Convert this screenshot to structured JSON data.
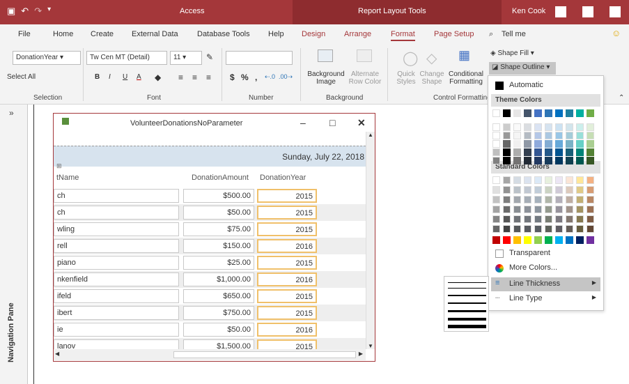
{
  "titlebar": {
    "title": "Access",
    "context_tab": "Report Layout Tools",
    "user": "Ken Cook"
  },
  "tabs": [
    "File",
    "Home",
    "Create",
    "External Data",
    "Database Tools",
    "Help",
    "Design",
    "Arrange",
    "Format",
    "Page Setup",
    "Tell me"
  ],
  "ribbon": {
    "selection": {
      "object": "DonationYear",
      "select_all": "Select All",
      "label": "Selection"
    },
    "font": {
      "name": "Tw Cen MT (Detail)",
      "size": "11",
      "label": "Font",
      "b": "B",
      "i": "I",
      "u": "U",
      "a": "A"
    },
    "number": {
      "label": "Number",
      "currency": "$",
      "percent": "%",
      "comma": ","
    },
    "background": {
      "bg_image": "Background Image",
      "alt_row": "Alternate Row Color",
      "label": "Background"
    },
    "control": {
      "quick": "Quick Styles",
      "change": "Change Shape",
      "conditional": "Conditional Formatting",
      "label": "Control Formatting",
      "shape_fill": "Shape Fill",
      "shape_outline": "Shape Outline"
    }
  },
  "navpane": {
    "label": "Navigation Pane",
    "chev": "»"
  },
  "report": {
    "title": "VolunteerDonationsNoParameter",
    "date": "Sunday, July 22, 2018",
    "headers": [
      "tName",
      "DonationAmount",
      "DonationYear"
    ],
    "rows": [
      {
        "name": "ch",
        "amount": "$500.00",
        "year": "2015"
      },
      {
        "name": "ch",
        "amount": "$50.00",
        "year": "2015"
      },
      {
        "name": "wling",
        "amount": "$75.00",
        "year": "2015"
      },
      {
        "name": "rell",
        "amount": "$150.00",
        "year": "2016"
      },
      {
        "name": "piano",
        "amount": "$25.00",
        "year": "2015"
      },
      {
        "name": "nkenfield",
        "amount": "$1,000.00",
        "year": "2016"
      },
      {
        "name": "ifeld",
        "amount": "$650.00",
        "year": "2015"
      },
      {
        "name": "ibert",
        "amount": "$750.00",
        "year": "2015"
      },
      {
        "name": "ie",
        "amount": "$50.00",
        "year": "2016"
      },
      {
        "name": "lanov",
        "amount": "$1,500.00",
        "year": "2015"
      }
    ]
  },
  "menu": {
    "automatic": "Automatic",
    "theme_colors": "Theme Colors",
    "standard_colors": "Standard Colors",
    "transparent": "Transparent",
    "more_colors": "More Colors...",
    "line_thickness": "Line Thickness",
    "line_type": "Line Type",
    "theme_palette": [
      "#ffffff",
      "#000000",
      "#e7e6e6",
      "#44546a",
      "#4472c4",
      "#2e75b6",
      "#0070c0",
      "#1f7fa0",
      "#00b0a0",
      "#70ad47"
    ],
    "standard_palette": [
      "#c00000",
      "#ff0000",
      "#ffc000",
      "#ffff00",
      "#92d050",
      "#00b050",
      "#00b0f0",
      "#0070c0",
      "#002060",
      "#7030a0"
    ]
  }
}
